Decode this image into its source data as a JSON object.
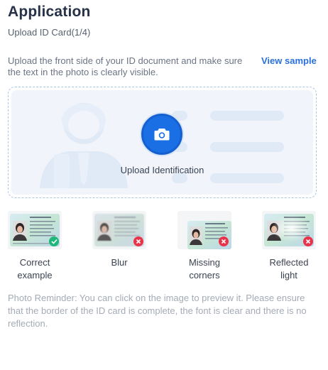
{
  "header": {
    "title": "Application",
    "step": "Upload ID Card(1/4)"
  },
  "instructions": {
    "text": "Upload the front side of your ID document and make sure the text in the photo is clearly visible.",
    "view_sample": "View sample"
  },
  "upload": {
    "label": "Upload Identification",
    "icon": "camera-icon",
    "accent": "#1b6fe5"
  },
  "examples": [
    {
      "label": "Correct example",
      "status": "ok",
      "badge_icon": "check-icon"
    },
    {
      "label": "Blur",
      "status": "bad",
      "badge_icon": "close-icon"
    },
    {
      "label": "Missing corners",
      "status": "bad",
      "badge_icon": "close-icon"
    },
    {
      "label": "Reflected light",
      "status": "bad",
      "badge_icon": "close-icon"
    }
  ],
  "reminder": "Photo Reminder: You can click on the image to preview it. Please ensure that the border of the ID card is complete, the font is clear and there is no reflection.",
  "colors": {
    "success": "#1fb77a",
    "error": "#e8334a",
    "link": "#2a6fdb"
  }
}
